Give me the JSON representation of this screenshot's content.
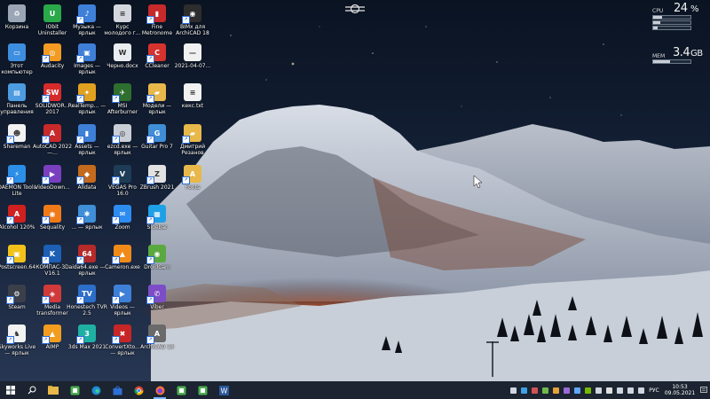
{
  "desktop_icons": [
    {
      "label": "Корзина",
      "icon": "recycle-bin-icon",
      "color": "#9aa6b5",
      "glyph": "♻",
      "shortcut": false
    },
    {
      "label": "IObit Uninstaller",
      "icon": "iobit-uninstaller-icon",
      "color": "#2aa84a",
      "glyph": "U",
      "shortcut": false
    },
    {
      "label": "Музыка — ярлык",
      "icon": "music-folder-icon",
      "color": "#3e7fd8",
      "glyph": "♪",
      "shortcut": true
    },
    {
      "label": "Курс молодого г...",
      "icon": "course-document-icon",
      "color": "#d4d8de",
      "glyph": "≡",
      "shortcut": false
    },
    {
      "label": "Fine Metronome",
      "icon": "metronome-icon",
      "color": "#c8292a",
      "glyph": "▮",
      "shortcut": true
    },
    {
      "label": "BIMx для ArchiCAD 18",
      "icon": "bimx-icon",
      "color": "#2d2d2d",
      "glyph": "◉",
      "shortcut": true
    },
    {
      "label": "Этот компьютер",
      "icon": "this-pc-icon",
      "color": "#3e8ee0",
      "glyph": "▭",
      "shortcut": false
    },
    {
      "label": "Audacity",
      "icon": "audacity-icon",
      "color": "#f29a22",
      "glyph": "◎",
      "shortcut": true
    },
    {
      "label": "Images — ярлык",
      "icon": "images-folder-icon",
      "color": "#3e7fd8",
      "glyph": "▣",
      "shortcut": true
    },
    {
      "label": "Черно.docx",
      "icon": "word-document-icon",
      "color": "#e9ecf0",
      "glyph": "W",
      "shortcut": false
    },
    {
      "label": "CCleaner",
      "icon": "ccleaner-icon",
      "color": "#d6332e",
      "glyph": "C",
      "shortcut": true
    },
    {
      "label": "2021-04-07...",
      "icon": "file-icon",
      "color": "#f0f0f0",
      "glyph": "—",
      "shortcut": false
    },
    {
      "label": "Панель управления",
      "icon": "control-panel-icon",
      "color": "#4d9be0",
      "glyph": "▤",
      "shortcut": false
    },
    {
      "label": "SOLIDWOR... 2017",
      "icon": "solidworks-icon",
      "color": "#d62b2b",
      "glyph": "SW",
      "shortcut": true
    },
    {
      "label": "RealTemp... — ярлык",
      "icon": "realtemp-icon",
      "color": "#e0a020",
      "glyph": "✦",
      "shortcut": true
    },
    {
      "label": "MSI Afterburner",
      "icon": "msi-afterburner-icon",
      "color": "#2e6e2e",
      "glyph": "✈",
      "shortcut": true
    },
    {
      "label": "Модели — ярлык",
      "icon": "models-folder-icon",
      "color": "#e8b84a",
      "glyph": "▰",
      "shortcut": true
    },
    {
      "label": "кекс.txt",
      "icon": "text-file-icon",
      "color": "#f2f2f2",
      "glyph": "≡",
      "shortcut": false
    },
    {
      "label": "Shareman",
      "icon": "shareman-icon",
      "color": "#f2f2f2",
      "glyph": "☻",
      "shortcut": true
    },
    {
      "label": "AutoCAD 2022 —...",
      "icon": "autocad-icon",
      "color": "#c8292a",
      "glyph": "A",
      "shortcut": true
    },
    {
      "label": "Assets — ярлык",
      "icon": "assets-folder-icon",
      "color": "#3e7fd8",
      "glyph": "▮",
      "shortcut": true
    },
    {
      "label": "ezcd.exe — ярлык",
      "icon": "ezcd-icon",
      "color": "#c9ced6",
      "glyph": "◎",
      "shortcut": true
    },
    {
      "label": "Guitar Pro 7",
      "icon": "guitar-pro-icon",
      "color": "#3f8ed6",
      "glyph": "G",
      "shortcut": true
    },
    {
      "label": "Дмитрий Резанов",
      "icon": "user-folder-icon",
      "color": "#e8b84a",
      "glyph": "▰",
      "shortcut": true
    },
    {
      "label": "DAEMON Tools Lite",
      "icon": "daemon-tools-icon",
      "color": "#2c8ee6",
      "glyph": "⚡",
      "shortcut": true
    },
    {
      "label": "VideoDown...",
      "icon": "video-downloader-icon",
      "color": "#7a3fbf",
      "glyph": "▶",
      "shortcut": true
    },
    {
      "label": "Alldata",
      "icon": "alldata-icon",
      "color": "#c46a1d",
      "glyph": "◆",
      "shortcut": true
    },
    {
      "label": "VEGAS Pro 16.0",
      "icon": "vegas-pro-icon",
      "color": "#1e3c55",
      "glyph": "V",
      "shortcut": true
    },
    {
      "label": "ZBrush 2021",
      "icon": "zbrush-icon",
      "color": "#e2e2e2",
      "glyph": "Z",
      "shortcut": true
    },
    {
      "label": "Fonts",
      "icon": "fonts-folder-icon",
      "color": "#e8b84a",
      "glyph": "A",
      "shortcut": true
    },
    {
      "label": "Alcohol 120%",
      "icon": "alcohol-icon",
      "color": "#d02020",
      "glyph": "A",
      "shortcut": true
    },
    {
      "label": "Sequality",
      "icon": "sequality-icon",
      "color": "#f07a18",
      "glyph": "◉",
      "shortcut": true
    },
    {
      "label": "... — ярлык",
      "icon": "app-shortcut-icon",
      "color": "#3f8ed6",
      "glyph": "✱",
      "shortcut": true
    },
    {
      "label": "Zoom",
      "icon": "chat-icon",
      "color": "#2d8cf0",
      "glyph": "✉",
      "shortcut": true
    },
    {
      "label": "Sidebar",
      "icon": "sidebar-app-icon",
      "color": "#1ea0e6",
      "glyph": "▦",
      "shortcut": true
    },
    {
      "label": "Postscreen.64",
      "icon": "postscreen-icon",
      "color": "#f2c21a",
      "glyph": "▣",
      "shortcut": true
    },
    {
      "label": "КОМПАС-3D V16.1",
      "icon": "kompas-icon",
      "color": "#1c5fb4",
      "glyph": "K",
      "shortcut": true
    },
    {
      "label": "aida64.exe — ярлык",
      "icon": "aida64-icon",
      "color": "#b52a2a",
      "glyph": "64",
      "shortcut": true
    },
    {
      "label": "Cameron.exe",
      "icon": "cameron-icon",
      "color": "#f08a18",
      "glyph": "▲",
      "shortcut": true
    },
    {
      "label": "DroidCam",
      "icon": "droidcam-icon",
      "color": "#5aa840",
      "glyph": "◉",
      "shortcut": true
    },
    {
      "label": "Steam",
      "icon": "steam-icon",
      "color": "#3a3f4a",
      "glyph": "⚙",
      "shortcut": true
    },
    {
      "label": "Media transformer",
      "icon": "media-transformer-icon",
      "color": "#d03a3a",
      "glyph": "◈",
      "shortcut": true
    },
    {
      "label": "Honestech TVR 2.5",
      "icon": "honestech-icon",
      "color": "#2d6ec8",
      "glyph": "TV",
      "shortcut": true
    },
    {
      "label": "Videos — ярлык",
      "icon": "videos-folder-icon",
      "color": "#3e7fd8",
      "glyph": "▶",
      "shortcut": true
    },
    {
      "label": "Viber",
      "icon": "viber-icon",
      "color": "#7d4dc7",
      "glyph": "✆",
      "shortcut": true
    },
    {
      "label": "Skyworks Live — ярлык",
      "icon": "skyworks-icon",
      "color": "#f2f2f2",
      "glyph": "♞",
      "shortcut": true
    },
    {
      "label": "AIMP",
      "icon": "aimp-icon",
      "color": "#f29d1d",
      "glyph": "▲",
      "shortcut": true
    },
    {
      "label": "3ds Max 2021",
      "icon": "3ds-max-icon",
      "color": "#1fb0a4",
      "glyph": "3",
      "shortcut": true
    },
    {
      "label": "ConvertXto... — ярлык",
      "icon": "convertxto-icon",
      "color": "#c82626",
      "glyph": "✖",
      "shortcut": true
    },
    {
      "label": "ArchiCAD 18",
      "icon": "archicad-icon",
      "color": "#6a6a6a",
      "glyph": "A",
      "shortcut": true
    }
  ],
  "sysmon": {
    "cpu_label": "CPU",
    "cpu_value": "24",
    "cpu_unit": "%",
    "cpu_fraction": 0.24,
    "mem_label": "MEM",
    "mem_value": "3.4",
    "mem_unit": "GB",
    "mem_fraction": 0.45
  },
  "taskbar": {
    "buttons": [
      {
        "icon": "windows-start-icon",
        "active": false
      },
      {
        "icon": "search-icon",
        "active": false
      },
      {
        "icon": "file-explorer-icon",
        "active": false
      },
      {
        "icon": "app-icon",
        "active": false
      },
      {
        "icon": "edge-icon",
        "active": false
      },
      {
        "icon": "store-icon",
        "active": false
      },
      {
        "icon": "chrome-icon",
        "active": false
      },
      {
        "icon": "firefox-icon",
        "active": true
      },
      {
        "icon": "app-icon",
        "active": false
      },
      {
        "icon": "app-icon",
        "active": false
      },
      {
        "icon": "word-icon",
        "active": false
      }
    ],
    "tray_icons": [
      "chat-tray-icon",
      "app-tray-icon",
      "app-tray-icon",
      "app-tray-icon",
      "app-tray-icon",
      "app-tray-icon",
      "app-tray-icon",
      "nvidia-tray-icon",
      "app-tray-icon",
      "app-tray-icon",
      "battery-tray-icon",
      "network-tray-icon",
      "volume-tray-icon"
    ],
    "language": "РУС",
    "time": "10:53",
    "date": "09.05.2021"
  }
}
